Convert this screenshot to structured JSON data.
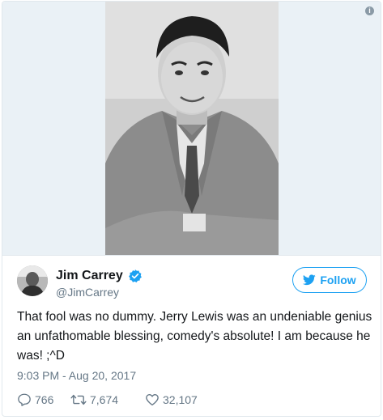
{
  "author": {
    "name": "Jim Carrey",
    "handle": "@JimCarrey",
    "verified": true
  },
  "follow_button": {
    "label": "Follow"
  },
  "tweet": {
    "text": "That fool was no dummy. Jerry Lewis was an undeniable genius an unfathomable blessing, comedy's absolute! I am because he was! ;^D",
    "timestamp": "9:03 PM - Aug 20, 2017"
  },
  "actions": {
    "replies": "766",
    "retweets": "7,674",
    "likes": "32,107"
  },
  "icons": {
    "info": "info-icon",
    "verified": "verified-badge-icon",
    "follow": "bird-icon",
    "reply": "reply-icon",
    "retweet": "retweet-icon",
    "like": "heart-icon"
  },
  "colors": {
    "accent": "#1da1f2",
    "text": "#14171a",
    "secondary_text": "#657786",
    "border": "#e1e8ed"
  }
}
